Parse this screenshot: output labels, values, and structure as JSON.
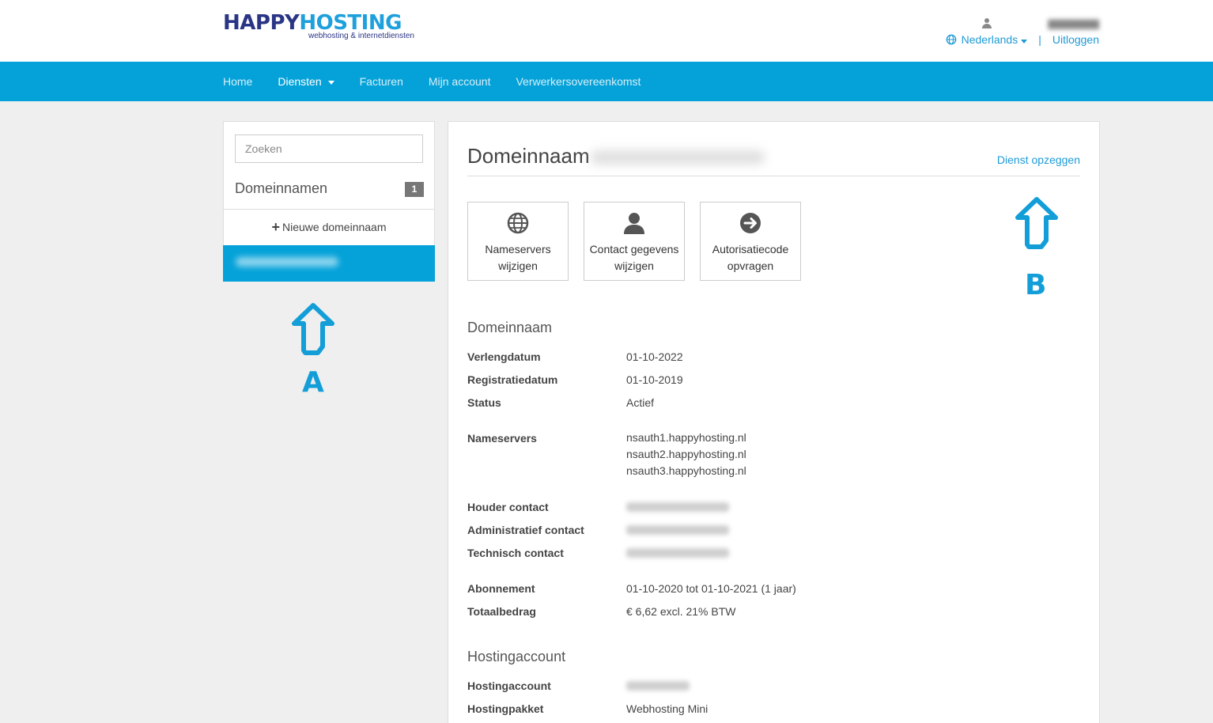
{
  "header": {
    "logo_part1": "HAPPY",
    "logo_part2": "HOSTING",
    "logo_tagline": "webhosting & internetdiensten",
    "language": "Nederlands",
    "logout": "Uitloggen",
    "separator": "|"
  },
  "nav": {
    "items": [
      {
        "label": "Home"
      },
      {
        "label": "Diensten"
      },
      {
        "label": "Facturen"
      },
      {
        "label": "Mijn account"
      },
      {
        "label": "Verwerkersovereenkomst"
      }
    ],
    "active": "Diensten"
  },
  "sidebar": {
    "search_placeholder": "Zoeken",
    "heading": "Domeinnamen",
    "count": "1",
    "new_domain": "Nieuwe domeinnaam"
  },
  "annotations": {
    "a": "A",
    "b": "B"
  },
  "main": {
    "title": "Domeinnaam",
    "cancel_link": "Dienst opzeggen",
    "actions": [
      {
        "icon": "globe-icon",
        "line1": "Nameservers",
        "line2": "wijzigen"
      },
      {
        "icon": "user-icon",
        "line1": "Contact gegevens",
        "line2": "wijzigen"
      },
      {
        "icon": "arrow-right-circle-icon",
        "line1": "Autorisatiecode",
        "line2": "opvragen"
      }
    ],
    "domain_section": {
      "title": "Domeinnaam",
      "verlengdatum_label": "Verlengdatum",
      "verlengdatum": "01-10-2022",
      "registratiedatum_label": "Registratiedatum",
      "registratiedatum": "01-10-2019",
      "status_label": "Status",
      "status": "Actief",
      "nameservers_label": "Nameservers",
      "nameservers": [
        "nsauth1.happyhosting.nl",
        "nsauth2.happyhosting.nl",
        "nsauth3.happyhosting.nl"
      ],
      "houder_label": "Houder contact",
      "admin_label": "Administratief contact",
      "tech_label": "Technisch contact",
      "abonnement_label": "Abonnement",
      "abonnement": "01-10-2020 tot 01-10-2021 (1 jaar)",
      "totaal_label": "Totaalbedrag",
      "totaal": "€ 6,62 excl. 21% BTW"
    },
    "hosting_section": {
      "title": "Hostingaccount",
      "account_label": "Hostingaccount",
      "pakket_label": "Hostingpakket",
      "pakket": "Webhosting Mini"
    }
  },
  "colors": {
    "brand_blue": "#05a2d9",
    "logo_navy": "#2a3585",
    "link_blue": "#1e9ad6",
    "annotation_blue": "#139ed8"
  }
}
